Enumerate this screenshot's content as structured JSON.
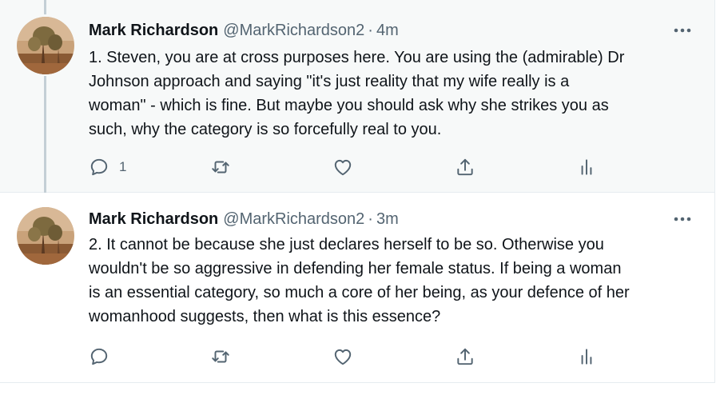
{
  "tweets": [
    {
      "author_name": "Mark Richardson",
      "handle": "@MarkRichardson2",
      "separator": "·",
      "time": "4m",
      "text": "1. Steven, you are at cross purposes here. You are using the (admirable) Dr\nJohnson approach and saying \"it's just reality that my wife really is a\nwoman\" - which is fine. But maybe you should ask why she strikes you as\nsuch, why the category is so forcefully real to you.",
      "reply_count": "1",
      "icons": {
        "reply": "reply-icon",
        "retweet": "retweet-icon",
        "like": "heart-icon",
        "share": "share-icon",
        "analytics": "analytics-icon",
        "more": "more-icon"
      }
    },
    {
      "author_name": "Mark Richardson",
      "handle": "@MarkRichardson2",
      "separator": "·",
      "time": "3m",
      "text": "2. It cannot be because she just declares herself to be so. Otherwise you\nwouldn't be so aggressive in defending her female status. If being a woman\nis an essential category, so much a core of her being, as your defence of her\nwomanhood suggests, then what is this essence?",
      "reply_count": "",
      "icons": {
        "reply": "reply-icon",
        "retweet": "retweet-icon",
        "like": "heart-icon",
        "share": "share-icon",
        "analytics": "analytics-icon",
        "more": "more-icon"
      }
    }
  ],
  "colors": {
    "text_primary": "#0f1419",
    "text_secondary": "#536471",
    "highlighted_background": "#f7f9f9",
    "thread_line": "#c4cfd6",
    "divider": "#e6ecf0"
  }
}
